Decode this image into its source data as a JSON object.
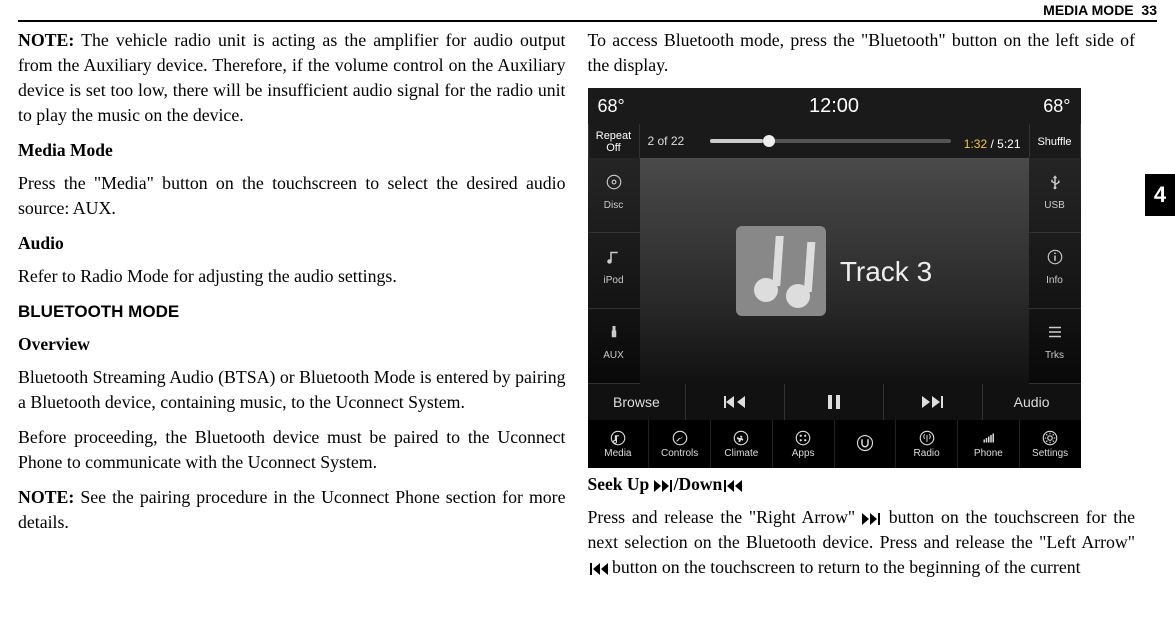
{
  "header": {
    "section": "MEDIA MODE",
    "page": "33"
  },
  "tab": "4",
  "left": {
    "p1_label": "NOTE:",
    "p1": " The vehicle radio unit is acting as the amplifier for audio output from the Auxiliary device. Therefore, if the volume control on the Auxiliary device is set too low, there will be insufficient audio signal for the radio unit to play the music on the device.",
    "h1": "Media Mode",
    "p2": "Press the \"Media\" button on the touchscreen to select the desired audio source: AUX.",
    "h2": "Audio",
    "p3": "Refer to Radio Mode for adjusting the audio settings.",
    "h3": "BLUETOOTH MODE",
    "h4": "Overview",
    "p4": "Bluetooth Streaming Audio (BTSA) or Bluetooth Mode is entered by pairing a Bluetooth device, containing music, to the Uconnect System.",
    "p5": "Before proceeding, the Bluetooth device must be paired to the Uconnect Phone to communicate with the Uconnect System.",
    "p6_label": "NOTE:",
    "p6": " See the pairing procedure in the Uconnect Phone section for more details."
  },
  "right": {
    "p1": "To access Bluetooth mode, press the \"Bluetooth\" button on the left side of the display.",
    "caption_pre": "Seek Up ",
    "caption_mid": "/Down",
    "p2a": "Press and release the \"Right Arrow\" ",
    "p2b": " button on the touchscreen for the next selection on the Bluetooth device. Press and release the \"Left Arrow\" ",
    "p2c": " button on the touchscreen to return to the beginning of the current"
  },
  "uconnect": {
    "temp_left": "68°",
    "time": "12:00",
    "temp_right": "68°",
    "repeat": "Repeat",
    "repeat2": "Off",
    "track_count": "2 of 22",
    "elapsed": "1:32",
    "total": " / 5:21",
    "shuffle": "Shuffle",
    "left_sources": [
      "Disc",
      "iPod",
      "AUX"
    ],
    "right_sources": [
      "USB",
      "Info",
      "Trks"
    ],
    "track": "Track 3",
    "controls": {
      "browse": "Browse",
      "audio": "Audio"
    },
    "bottom": [
      "Media",
      "Controls",
      "Climate",
      "Apps",
      "",
      "Radio",
      "Phone",
      "Settings"
    ]
  }
}
